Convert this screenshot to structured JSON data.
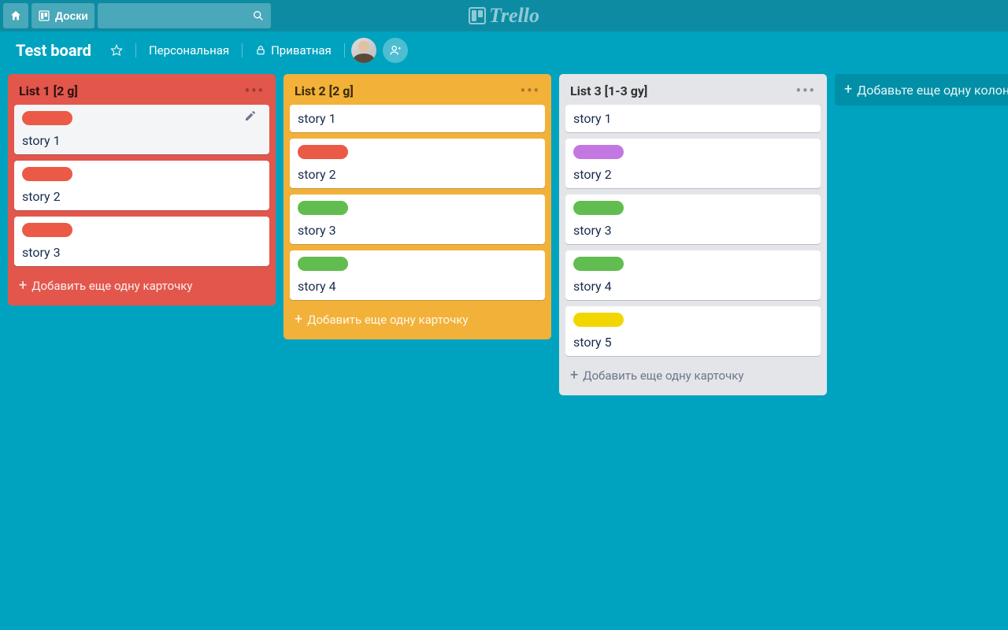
{
  "header": {
    "boards_label": "Доски",
    "logo_text": "Trello"
  },
  "board": {
    "title": "Test board",
    "visibility_team": "Персональная",
    "visibility_private": "Приватная"
  },
  "labels": {
    "add_card": "Добавить еще одну карточку",
    "add_list": "Добавьте еще одну колонку"
  },
  "lists": [
    {
      "title": "List 1 [2 g]",
      "style": "red",
      "cards": [
        {
          "title": "story 1",
          "label": "red",
          "hovered": true
        },
        {
          "title": "story 2",
          "label": "red"
        },
        {
          "title": "story 3",
          "label": "red"
        }
      ]
    },
    {
      "title": "List 2 [2 g]",
      "style": "yellow",
      "cards": [
        {
          "title": "story 1"
        },
        {
          "title": "story 2",
          "label": "red"
        },
        {
          "title": "story 3",
          "label": "green"
        },
        {
          "title": "story 4",
          "label": "green"
        }
      ]
    },
    {
      "title": "List 3 [1-3 gy]",
      "style": "grey",
      "cards": [
        {
          "title": "story 1"
        },
        {
          "title": "story 2",
          "label": "purple"
        },
        {
          "title": "story 3",
          "label": "green"
        },
        {
          "title": "story 4",
          "label": "green"
        },
        {
          "title": "story 5",
          "label": "yellow"
        }
      ]
    }
  ]
}
